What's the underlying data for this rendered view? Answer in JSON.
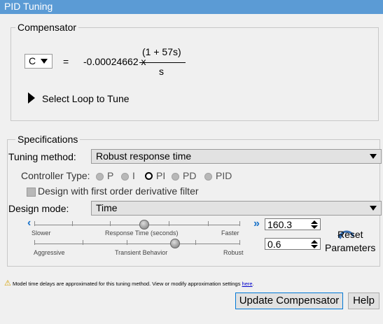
{
  "window": {
    "title": "PID Tuning"
  },
  "compensator": {
    "legend": "Compensator",
    "select": "C",
    "equals": "=",
    "gain": "-0.00024662 x",
    "numerator": "(1 + 57s)",
    "denominator": "s",
    "loop_label": "Select Loop to Tune"
  },
  "specifications": {
    "legend": "Specifications",
    "tuning_label": "Tuning method:",
    "tuning_value": "Robust response time",
    "controller_label": "Controller Type:",
    "controller_options": [
      "P",
      "I",
      "PI",
      "PD",
      "PID"
    ],
    "controller_selected": "PI",
    "filter_label": "Design with first order derivative filter",
    "filter_checked": false,
    "design_mode_label": "Design mode:",
    "design_mode_value": "Time",
    "response_slider": {
      "left": "Slower",
      "center": "Response Time (seconds)",
      "right": "Faster",
      "value": "160.3"
    },
    "transient_slider": {
      "left": "Aggressive",
      "center": "Transient Behavior",
      "right": "Robust",
      "value": "0.6"
    },
    "reset_line1": "Reset",
    "reset_line2": "Parameters"
  },
  "note": {
    "text": "Model time delays are approximated for this tuning method. View or modify approximation settings",
    "link": "here",
    "after": "."
  },
  "buttons": {
    "update": "Update Compensator",
    "help": "Help"
  }
}
